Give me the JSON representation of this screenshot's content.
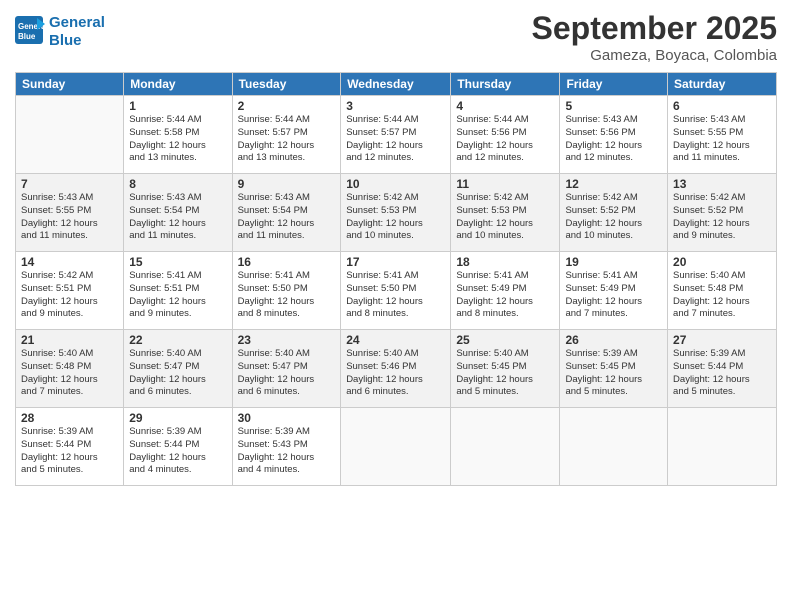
{
  "logo": {
    "line1": "General",
    "line2": "Blue"
  },
  "title": "September 2025",
  "location": "Gameza, Boyaca, Colombia",
  "days_of_week": [
    "Sunday",
    "Monday",
    "Tuesday",
    "Wednesday",
    "Thursday",
    "Friday",
    "Saturday"
  ],
  "weeks": [
    [
      {
        "day": "",
        "info": ""
      },
      {
        "day": "1",
        "info": "Sunrise: 5:44 AM\nSunset: 5:58 PM\nDaylight: 12 hours\nand 13 minutes."
      },
      {
        "day": "2",
        "info": "Sunrise: 5:44 AM\nSunset: 5:57 PM\nDaylight: 12 hours\nand 13 minutes."
      },
      {
        "day": "3",
        "info": "Sunrise: 5:44 AM\nSunset: 5:57 PM\nDaylight: 12 hours\nand 12 minutes."
      },
      {
        "day": "4",
        "info": "Sunrise: 5:44 AM\nSunset: 5:56 PM\nDaylight: 12 hours\nand 12 minutes."
      },
      {
        "day": "5",
        "info": "Sunrise: 5:43 AM\nSunset: 5:56 PM\nDaylight: 12 hours\nand 12 minutes."
      },
      {
        "day": "6",
        "info": "Sunrise: 5:43 AM\nSunset: 5:55 PM\nDaylight: 12 hours\nand 11 minutes."
      }
    ],
    [
      {
        "day": "7",
        "info": "Sunrise: 5:43 AM\nSunset: 5:55 PM\nDaylight: 12 hours\nand 11 minutes."
      },
      {
        "day": "8",
        "info": "Sunrise: 5:43 AM\nSunset: 5:54 PM\nDaylight: 12 hours\nand 11 minutes."
      },
      {
        "day": "9",
        "info": "Sunrise: 5:43 AM\nSunset: 5:54 PM\nDaylight: 12 hours\nand 11 minutes."
      },
      {
        "day": "10",
        "info": "Sunrise: 5:42 AM\nSunset: 5:53 PM\nDaylight: 12 hours\nand 10 minutes."
      },
      {
        "day": "11",
        "info": "Sunrise: 5:42 AM\nSunset: 5:53 PM\nDaylight: 12 hours\nand 10 minutes."
      },
      {
        "day": "12",
        "info": "Sunrise: 5:42 AM\nSunset: 5:52 PM\nDaylight: 12 hours\nand 10 minutes."
      },
      {
        "day": "13",
        "info": "Sunrise: 5:42 AM\nSunset: 5:52 PM\nDaylight: 12 hours\nand 9 minutes."
      }
    ],
    [
      {
        "day": "14",
        "info": "Sunrise: 5:42 AM\nSunset: 5:51 PM\nDaylight: 12 hours\nand 9 minutes."
      },
      {
        "day": "15",
        "info": "Sunrise: 5:41 AM\nSunset: 5:51 PM\nDaylight: 12 hours\nand 9 minutes."
      },
      {
        "day": "16",
        "info": "Sunrise: 5:41 AM\nSunset: 5:50 PM\nDaylight: 12 hours\nand 8 minutes."
      },
      {
        "day": "17",
        "info": "Sunrise: 5:41 AM\nSunset: 5:50 PM\nDaylight: 12 hours\nand 8 minutes."
      },
      {
        "day": "18",
        "info": "Sunrise: 5:41 AM\nSunset: 5:49 PM\nDaylight: 12 hours\nand 8 minutes."
      },
      {
        "day": "19",
        "info": "Sunrise: 5:41 AM\nSunset: 5:49 PM\nDaylight: 12 hours\nand 7 minutes."
      },
      {
        "day": "20",
        "info": "Sunrise: 5:40 AM\nSunset: 5:48 PM\nDaylight: 12 hours\nand 7 minutes."
      }
    ],
    [
      {
        "day": "21",
        "info": "Sunrise: 5:40 AM\nSunset: 5:48 PM\nDaylight: 12 hours\nand 7 minutes."
      },
      {
        "day": "22",
        "info": "Sunrise: 5:40 AM\nSunset: 5:47 PM\nDaylight: 12 hours\nand 6 minutes."
      },
      {
        "day": "23",
        "info": "Sunrise: 5:40 AM\nSunset: 5:47 PM\nDaylight: 12 hours\nand 6 minutes."
      },
      {
        "day": "24",
        "info": "Sunrise: 5:40 AM\nSunset: 5:46 PM\nDaylight: 12 hours\nand 6 minutes."
      },
      {
        "day": "25",
        "info": "Sunrise: 5:40 AM\nSunset: 5:45 PM\nDaylight: 12 hours\nand 5 minutes."
      },
      {
        "day": "26",
        "info": "Sunrise: 5:39 AM\nSunset: 5:45 PM\nDaylight: 12 hours\nand 5 minutes."
      },
      {
        "day": "27",
        "info": "Sunrise: 5:39 AM\nSunset: 5:44 PM\nDaylight: 12 hours\nand 5 minutes."
      }
    ],
    [
      {
        "day": "28",
        "info": "Sunrise: 5:39 AM\nSunset: 5:44 PM\nDaylight: 12 hours\nand 5 minutes."
      },
      {
        "day": "29",
        "info": "Sunrise: 5:39 AM\nSunset: 5:44 PM\nDaylight: 12 hours\nand 4 minutes."
      },
      {
        "day": "30",
        "info": "Sunrise: 5:39 AM\nSunset: 5:43 PM\nDaylight: 12 hours\nand 4 minutes."
      },
      {
        "day": "",
        "info": ""
      },
      {
        "day": "",
        "info": ""
      },
      {
        "day": "",
        "info": ""
      },
      {
        "day": "",
        "info": ""
      }
    ]
  ]
}
